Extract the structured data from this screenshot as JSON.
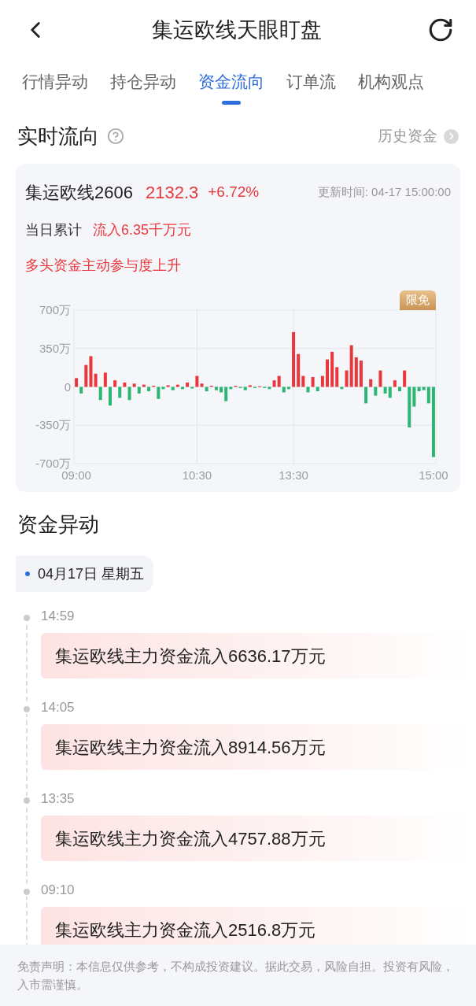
{
  "header": {
    "title": "集运欧线天眼盯盘"
  },
  "tabs": [
    {
      "label": "行情异动",
      "selected": false
    },
    {
      "label": "持仓异动",
      "selected": false
    },
    {
      "label": "资金流向",
      "selected": true
    },
    {
      "label": "订单流",
      "selected": false
    },
    {
      "label": "机构观点",
      "selected": false
    }
  ],
  "realtime": {
    "title": "实时流向",
    "history_link": "历史资金",
    "contract": "集运欧线2606",
    "price": "2132.3",
    "change": "+6.72%",
    "updated": "更新时间: 04-17 15:00:00",
    "cumulative_label": "当日累计",
    "cumulative_value": "流入6.35千万元",
    "signal": "多头资金主动参与度上升",
    "badge": "限免",
    "chart_data": {
      "type": "bar",
      "ylim": [
        -700,
        700
      ],
      "yticks": [
        {
          "value": 700,
          "label": "700万"
        },
        {
          "value": 350,
          "label": "350万"
        },
        {
          "value": 0,
          "label": "0"
        },
        {
          "value": -350,
          "label": "-350万"
        },
        {
          "value": -700,
          "label": "-700万"
        }
      ],
      "grid": true,
      "categories": [
        "09:00",
        null,
        null,
        null,
        null,
        null,
        null,
        null,
        null,
        null,
        null,
        null,
        null,
        null,
        null,
        null,
        null,
        null,
        null,
        null,
        null,
        null,
        null,
        null,
        null,
        "10:30",
        null,
        null,
        null,
        null,
        null,
        null,
        null,
        null,
        null,
        null,
        null,
        null,
        null,
        null,
        null,
        null,
        null,
        null,
        null,
        "13:30",
        null,
        null,
        null,
        null,
        null,
        null,
        null,
        null,
        null,
        null,
        null,
        null,
        null,
        null,
        null,
        null,
        null,
        null,
        null,
        null,
        null,
        null,
        null,
        null,
        null,
        null,
        null,
        null,
        "15:00"
      ],
      "values": [
        80,
        -60,
        200,
        280,
        120,
        -120,
        130,
        -170,
        60,
        -100,
        40,
        -120,
        30,
        -60,
        20,
        -40,
        10,
        -110,
        -20,
        15,
        -30,
        20,
        -20,
        40,
        -15,
        100,
        30,
        -40,
        10,
        -30,
        -50,
        -130,
        -20,
        10,
        -10,
        -30,
        15,
        -10,
        5,
        -10,
        -20,
        60,
        100,
        -50,
        -20,
        500,
        300,
        100,
        -50,
        90,
        -40,
        100,
        250,
        320,
        180,
        -20,
        150,
        380,
        270,
        240,
        -150,
        70,
        -80,
        150,
        -60,
        -100,
        60,
        -40,
        150,
        -370,
        -180,
        -40,
        -30,
        -150,
        -640
      ]
    }
  },
  "movements": {
    "title": "资金异动",
    "date": "04月17日 星期五",
    "events": [
      {
        "time": "14:59",
        "text": "集运欧线主力资金流入6636.17万元"
      },
      {
        "time": "14:05",
        "text": "集运欧线主力资金流入8914.56万元"
      },
      {
        "time": "13:35",
        "text": "集运欧线主力资金流入4757.88万元"
      },
      {
        "time": "09:10",
        "text": "集运欧线主力资金流入2516.8万元"
      }
    ]
  },
  "disclaimer": "免责声明：本信息仅供参考，不构成投资建议。据此交易，风险自担。投资有风险，入市需谨慎。"
}
